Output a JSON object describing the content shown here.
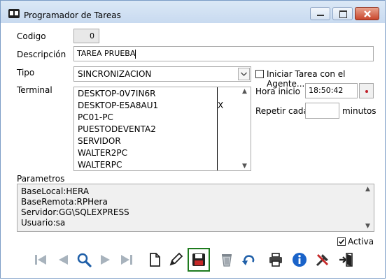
{
  "window": {
    "title": "Programador de Tareas"
  },
  "form": {
    "codigo_label": "Codigo",
    "codigo_value": "0",
    "descripcion_label": "Descripción",
    "descripcion_value": "TAREA PRUEBA",
    "tipo_label": "Tipo",
    "tipo_value": "SINCRONIZACION",
    "iniciar_agente_label": "Iniciar Tarea con el Agente...",
    "terminal_label": "Terminal",
    "hora_inicio_label": "Hora inicio",
    "hora_inicio_value": "18:50:42",
    "repetir_label": "Repetir cada",
    "repetir_value": "",
    "minutos_label": "minutos"
  },
  "terminals": [
    {
      "name": "DESKTOP-0V7IN6R",
      "mark": ""
    },
    {
      "name": "DESKTOP-E5A8AU1",
      "mark": "X"
    },
    {
      "name": "PC01-PC",
      "mark": ""
    },
    {
      "name": "PUESTODEVENTA2",
      "mark": ""
    },
    {
      "name": "SERVIDOR",
      "mark": ""
    },
    {
      "name": "WALTER2PC",
      "mark": ""
    },
    {
      "name": "WALTERPC",
      "mark": ""
    }
  ],
  "parametros": {
    "label": "Parametros",
    "lines": [
      "BaseLocal:HERA",
      "BaseRemota:RPHera",
      "Servidor:GG\\SQLEXPRESS",
      "Usuario:sa"
    ]
  },
  "activa": {
    "label": "Activa",
    "checked": true
  },
  "colors": {
    "accent": "#1e7b1e",
    "title_bg": "#dbe8f6",
    "close": "#c9462c"
  }
}
